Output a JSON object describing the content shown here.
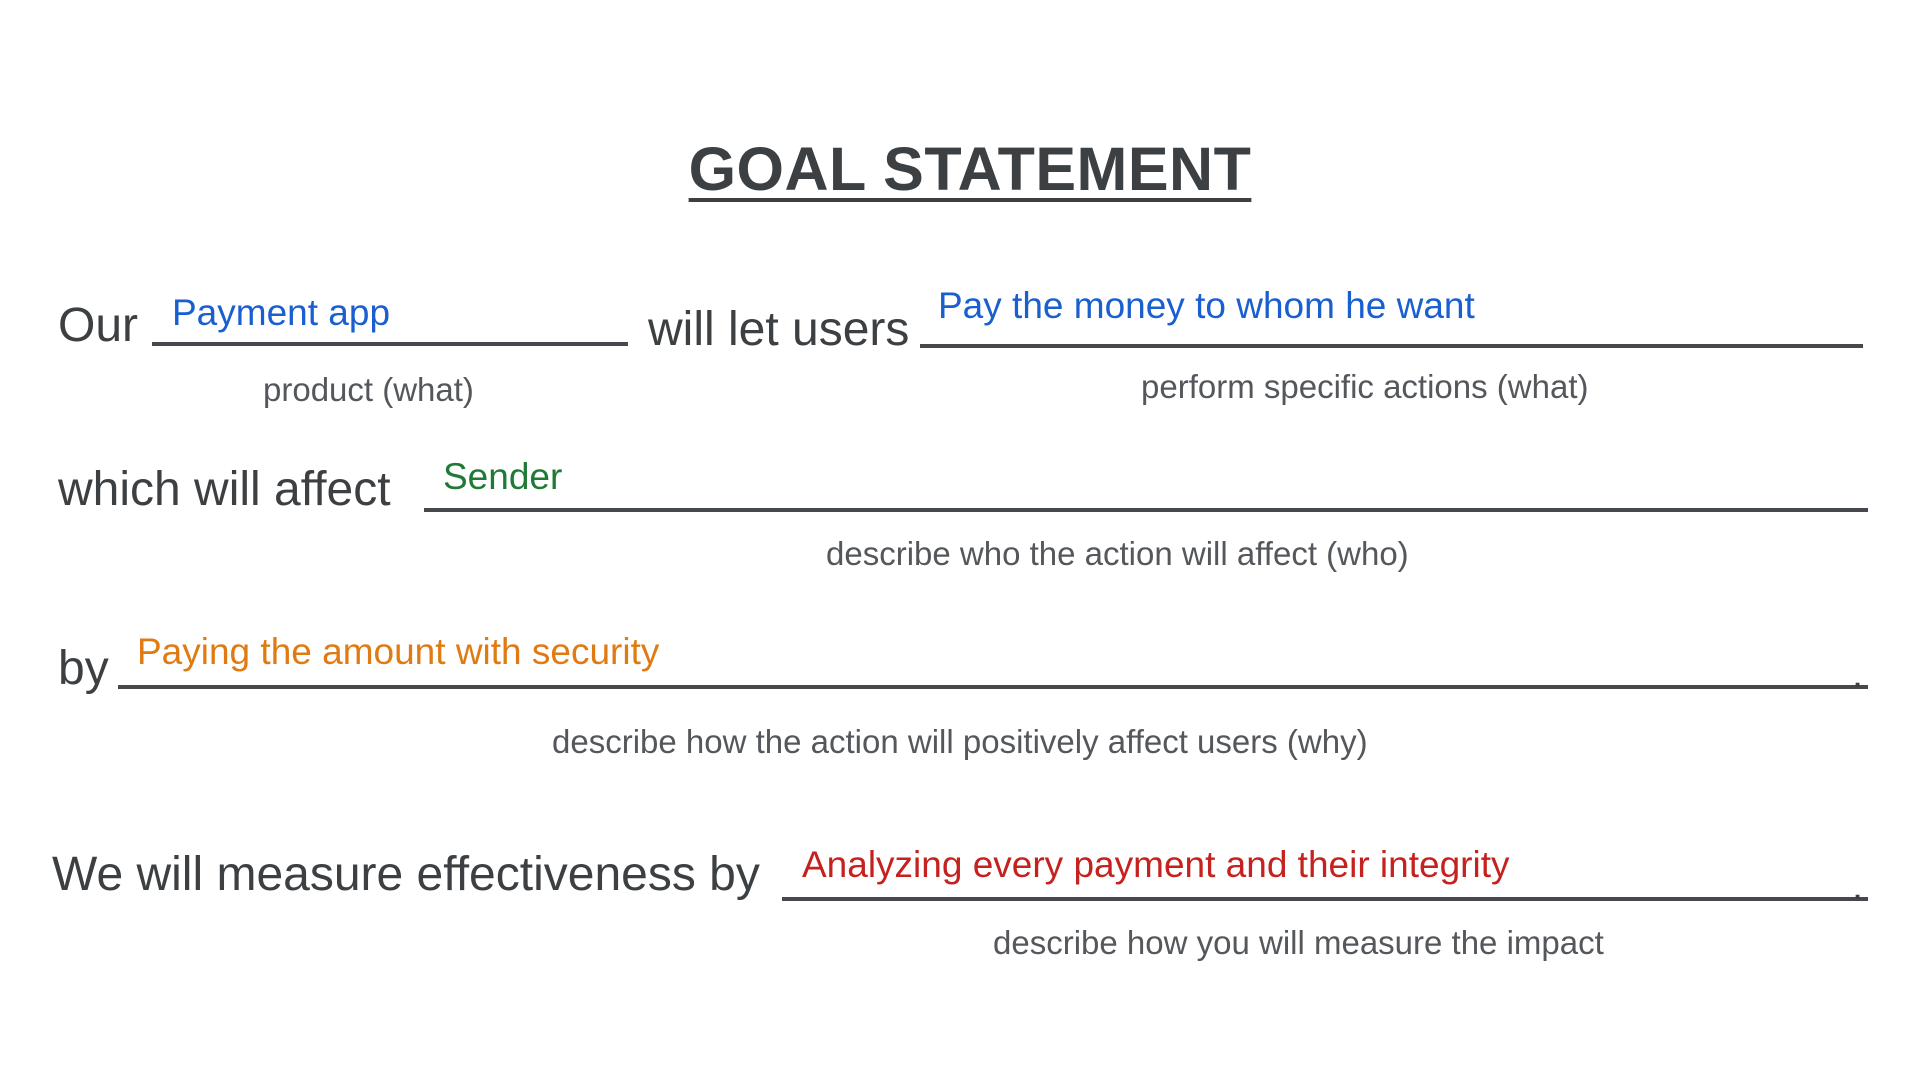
{
  "title": "GOAL STATEMENT",
  "colors": {
    "text": "#3c4043",
    "product": "#1a5fd0",
    "affect": "#1e7a34",
    "benefit": "#e07b13",
    "measure": "#c5221f"
  },
  "row1": {
    "lead": "Our",
    "product_value": "Payment app",
    "product_hint": "product (what)",
    "middle": "will let users",
    "action_value": "Pay the money to whom he want",
    "action_hint": "perform specific actions (what)"
  },
  "row2": {
    "lead": "which will affect",
    "value": "Sender",
    "hint": "describe who the action will affect (who)"
  },
  "row3": {
    "lead": "by",
    "value": "Paying the amount with security",
    "hint": "describe how the action will positively affect users (why)",
    "end": "."
  },
  "row4": {
    "lead": "We will measure effectiveness by",
    "value": "Analyzing every payment and their integrity",
    "hint": "describe how you will measure the impact",
    "end": "."
  }
}
